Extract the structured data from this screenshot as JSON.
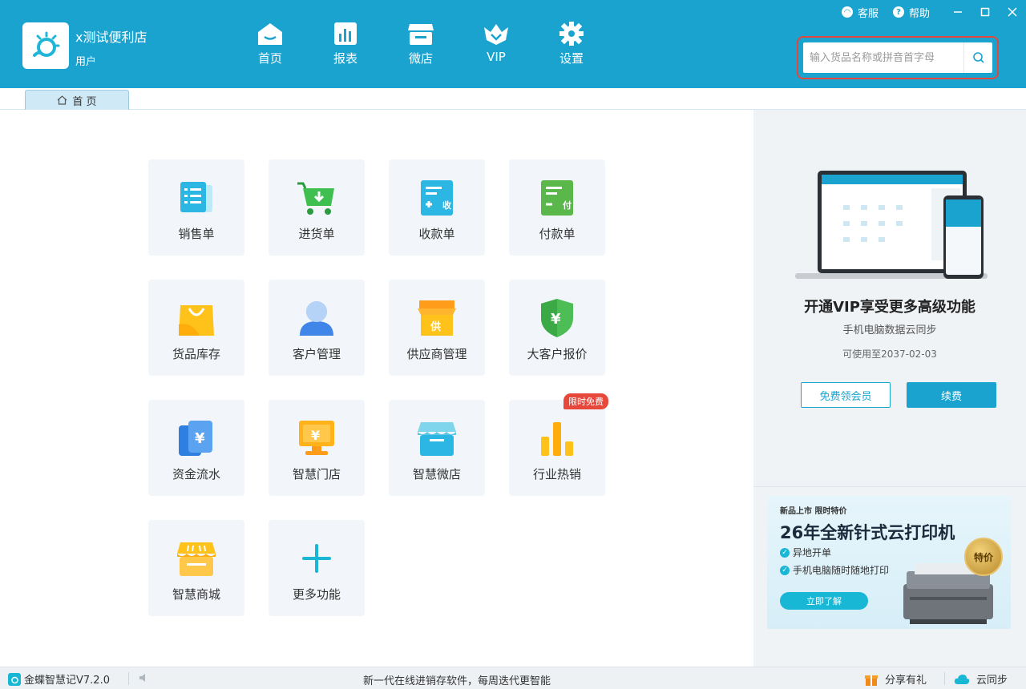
{
  "header": {
    "store_name": "x测试便利店",
    "user_role": "用户",
    "nav": [
      {
        "label": "首页",
        "icon": "home-icon"
      },
      {
        "label": "报表",
        "icon": "report-icon"
      },
      {
        "label": "微店",
        "icon": "shop-icon"
      },
      {
        "label": "VIP",
        "icon": "vip-crown-icon"
      },
      {
        "label": "设置",
        "icon": "gear-icon"
      }
    ],
    "top_links": {
      "service": "客服",
      "help": "帮助"
    },
    "search": {
      "placeholder": "输入货品名称或拼音首字母"
    }
  },
  "tabs": {
    "home_label": "首 页"
  },
  "tiles": [
    {
      "label": "销售单",
      "icon": "sales-order-icon"
    },
    {
      "label": "进货单",
      "icon": "purchase-cart-icon"
    },
    {
      "label": "收款单",
      "icon": "receipt-icon"
    },
    {
      "label": "付款单",
      "icon": "payment-icon"
    },
    {
      "label": "货品库存",
      "icon": "shopping-bag-icon"
    },
    {
      "label": "客户管理",
      "icon": "customer-icon"
    },
    {
      "label": "供应商管理",
      "icon": "supplier-icon"
    },
    {
      "label": "大客户报价",
      "icon": "shield-yen-icon"
    },
    {
      "label": "资金流水",
      "icon": "funds-icon"
    },
    {
      "label": "智慧门店",
      "icon": "smart-store-icon"
    },
    {
      "label": "智慧微店",
      "icon": "micro-store-icon"
    },
    {
      "label": "行业热销",
      "icon": "bar-chart-icon",
      "badge": "限时免费"
    },
    {
      "label": "智慧商城",
      "icon": "mall-icon"
    },
    {
      "label": "更多功能",
      "icon": "plus-icon"
    }
  ],
  "vip": {
    "title": "开通VIP享受更多高级功能",
    "subtitle": "手机电脑数据云同步",
    "valid_until": "可使用至2037-02-03",
    "free_button": "免费领会员",
    "renew_button": "续费"
  },
  "promo": {
    "tag": "新品上市 限时特价",
    "title": "26年全新针式云打印机",
    "points": [
      "异地开单",
      "手机电脑随时随地打印"
    ],
    "cta": "立即了解",
    "seal": "特价"
  },
  "statusbar": {
    "version": "金蝶智慧记V7.2.0",
    "message": "新一代在线进销存软件，每周迭代更智能",
    "share": "分享有礼",
    "sync": "云同步"
  },
  "colors": {
    "header_bg": "#1aa3cf",
    "search_highlight": "#e0483e",
    "tile_bg": "#f2f6fa",
    "accent": "#1aa3cf",
    "badge_red": "#e8483c"
  }
}
